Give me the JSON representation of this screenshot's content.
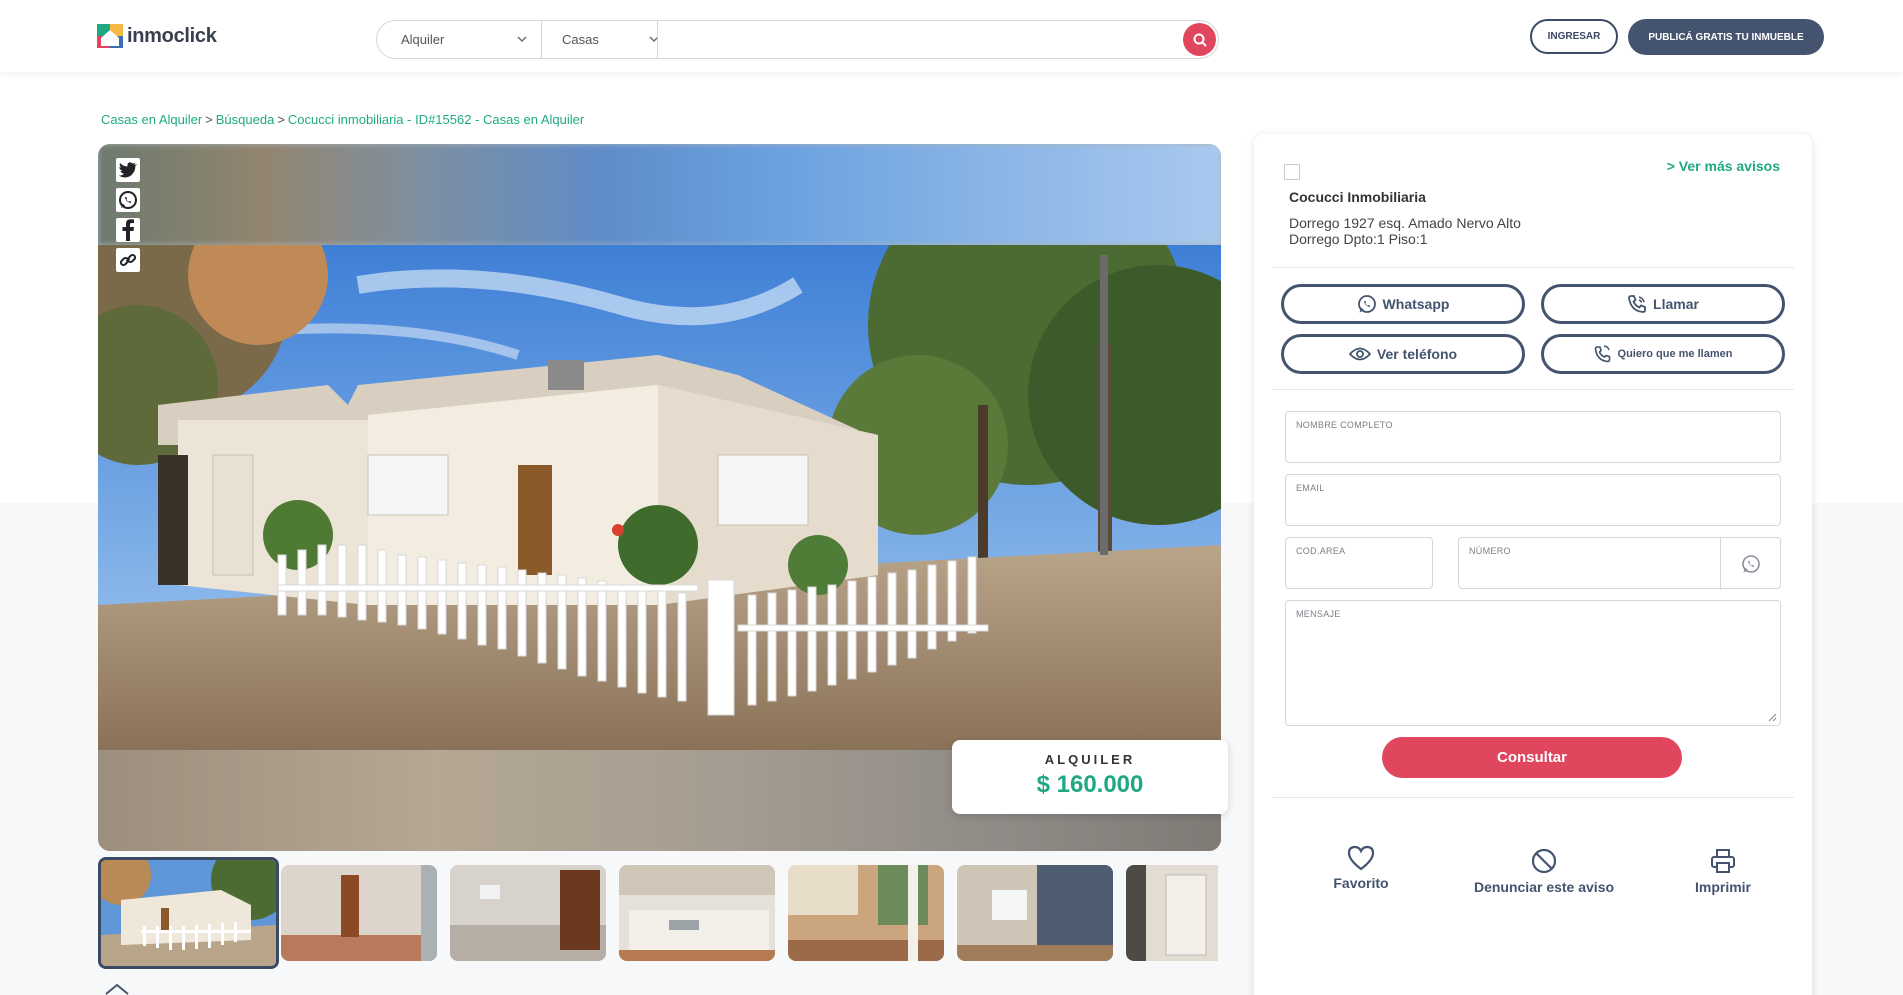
{
  "header": {
    "logo_text": "inmoclick",
    "operation_select": "Alquiler",
    "type_select": "Casas",
    "search_placeholder": "",
    "login_label": "INGRESAR",
    "publish_label": "PUBLICÁ GRATIS TU INMUEBLE"
  },
  "breadcrumb": {
    "items": [
      "Casas en Alquiler",
      "Búsqueda",
      "Cocucci inmobiliaria - ID#15562 - Casas en Alquiler"
    ],
    "separator": ">"
  },
  "gallery": {
    "share_icons": [
      "twitter-icon",
      "whatsapp-icon",
      "facebook-icon",
      "link-icon"
    ],
    "operation": "ALQUILER",
    "price": "$ 160.000",
    "thumbnail_count": 7
  },
  "agency": {
    "name": "Cocucci Inmobiliaria",
    "address_line1": "Dorrego 1927 esq. Amado Nervo Alto",
    "address_line2": "Dorrego Dpto:1 Piso:1",
    "more_link": "> Ver más avisos"
  },
  "contact_buttons": {
    "whatsapp": "Whatsapp",
    "call": "Llamar",
    "phone": "Ver teléfono",
    "callback": "Quiero que me llamen"
  },
  "form": {
    "name_label": "NOMBRE COMPLETO",
    "email_label": "EMAIL",
    "area_label": "COD.AREA",
    "number_label": "NÚMERO",
    "message_label": "MENSAJE",
    "submit_label": "Consultar"
  },
  "actions": {
    "favorite": "Favorito",
    "report": "Denunciar este aviso",
    "print": "Imprimir"
  },
  "colors": {
    "accent_green": "#20a884",
    "accent_red": "#e0475f",
    "navy": "#44546f"
  }
}
